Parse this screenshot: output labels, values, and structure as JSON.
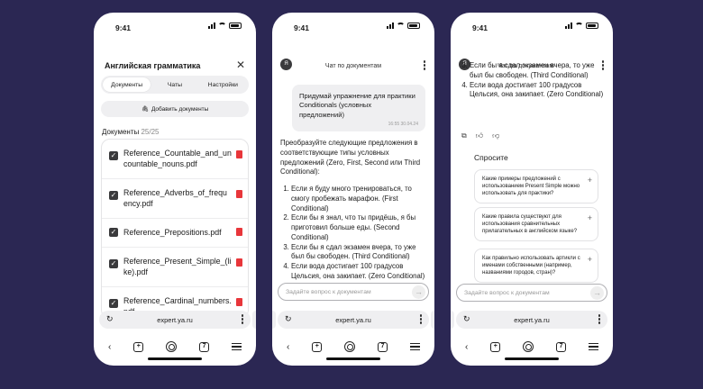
{
  "status": {
    "time": "9:41"
  },
  "phone1": {
    "title": "Английская грамматика",
    "tabs": [
      "Документы",
      "Чаты",
      "Настройки"
    ],
    "add_docs": "Добавить документы",
    "docs_label": "Документы",
    "docs_count": "25/25",
    "docs": [
      [
        "Reference_Countable_and_un",
        "countable_nouns.pdf"
      ],
      [
        "Reference_Adverbs_of_frequ",
        "ency.pdf"
      ],
      [
        "Reference_Prepositions.pdf",
        ""
      ],
      [
        "Reference_Present_Simple_(li",
        "ke).pdf"
      ],
      [
        "Reference_Cardinal_numbers.",
        "pdf"
      ]
    ]
  },
  "phone2": {
    "header": "Чат по документам",
    "logo": "Я",
    "user_msg": "Придумай упражнение для практики Conditionals (условных предложений)",
    "user_ts": "16:55 30.04.24",
    "answer_intro": "Преобразуйте следующие предложения в соответствующие типы условных предложений (Zero, First, Second или Third Conditional):",
    "answer_items": [
      "Если я буду много тренироваться, то смогу пробежать марафон. (First Conditional)",
      "Если бы я знал, что ты придёшь, я бы приготовил больше еды. (Second Conditional)",
      "Если бы я сдал экзамен вчера, то уже был бы свободен. (Third Conditional)",
      "Если вода достигает 100 градусов Цельсия, она закипает. (Zero Conditional)"
    ],
    "input_placeholder": "Задайте вопрос к документам"
  },
  "phone3": {
    "header": "Чат по документам",
    "logo": "Я",
    "answer_items": [
      "Если бы я сдал экзамен вчера, то уже был бы свободен. (Third Conditional)",
      "Если вода достигает 100 градусов Цельсия, она закипает. (Zero Conditional)"
    ],
    "ask_title": "Спросите",
    "suggestions": [
      "Какие примеры предложений с использованием Present Simple можно использовать для практики?",
      "Какие правила существуют для использования сравнительных прилагательных в английском языке?",
      "Как правильно использовать артикли с именами собственными (например, названиями городов, стран)?"
    ],
    "input_placeholder": "Задайте вопрос к документам"
  },
  "browser": {
    "url": "expert.ya.ru",
    "tabs_count": "7"
  }
}
